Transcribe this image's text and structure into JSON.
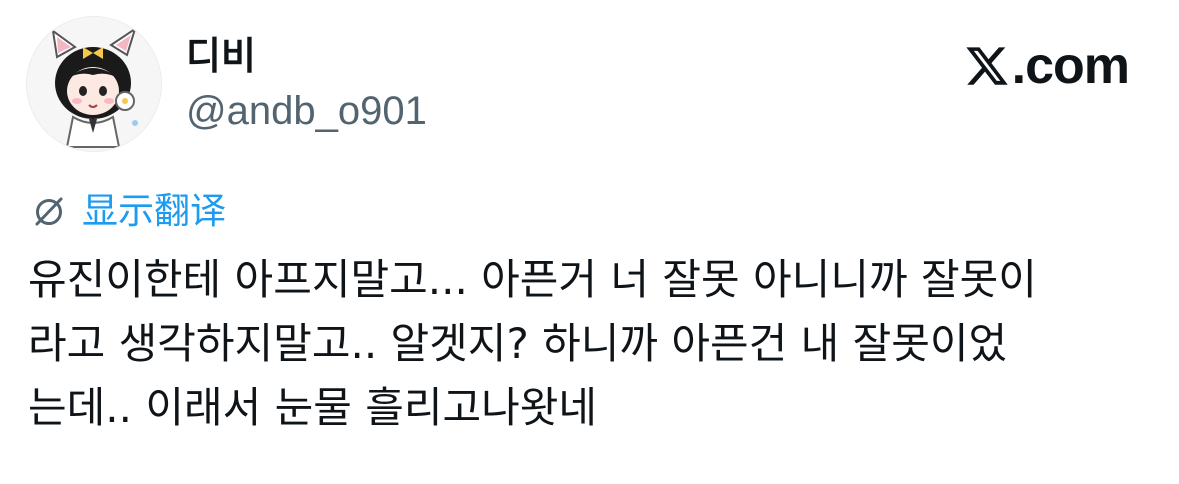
{
  "author": {
    "display_name": "디비",
    "handle": "@andb_o901",
    "avatar_icon": "cartoon-avatar-icon"
  },
  "brand": {
    "icon": "x-logo-icon",
    "text": ".com"
  },
  "translate": {
    "icon": "globe-slash-icon",
    "label": "显示翻译",
    "color": "#1d9bf0"
  },
  "tweet": {
    "lines": [
      "유진이한테 아프지말고... 아픈거 너 잘못 아니니까 잘못이",
      "라고 생각하지말고.. 알겟지? 하니까 아픈건 내 잘못이었",
      "는데.. 이래서 눈물 흘리고나왓네"
    ]
  },
  "colors": {
    "text": "#0f1419",
    "secondary": "#536471",
    "accent": "#1d9bf0",
    "background": "#ffffff"
  }
}
